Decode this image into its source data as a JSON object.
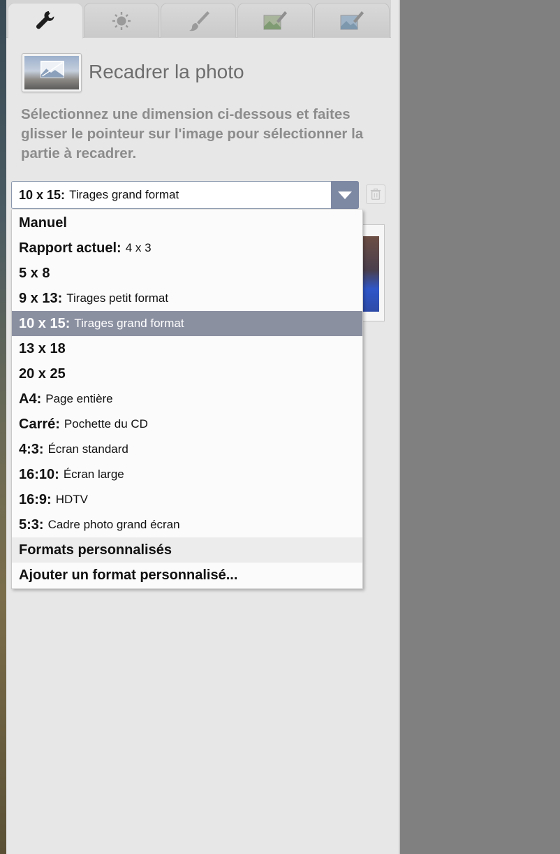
{
  "tabs": [
    {
      "icon": "wrench-icon",
      "active": true
    },
    {
      "icon": "sun-icon",
      "active": false
    },
    {
      "icon": "brush-icon",
      "active": false
    },
    {
      "icon": "image-brush-green-icon",
      "active": false
    },
    {
      "icon": "image-brush-blue-icon",
      "active": false
    }
  ],
  "header": {
    "title": "Recadrer la photo",
    "instructions": "Sélectionnez une dimension ci-dessous et faites glisser le pointeur sur l'image pour sélectionner la partie à recadrer."
  },
  "select": {
    "selected_bold": "10 x 15:",
    "selected_desc": "Tirages grand format"
  },
  "options": [
    {
      "bold": "Manuel",
      "desc": ""
    },
    {
      "bold": "Rapport actuel:",
      "desc": "4 x 3"
    },
    {
      "bold": "5 x 8",
      "desc": ""
    },
    {
      "bold": "9 x 13:",
      "desc": "Tirages petit format"
    },
    {
      "bold": "10 x 15:",
      "desc": "Tirages grand format"
    },
    {
      "bold": "13 x 18",
      "desc": ""
    },
    {
      "bold": "20 x 25",
      "desc": ""
    },
    {
      "bold": "A4:",
      "desc": "Page entière"
    },
    {
      "bold": "Carré:",
      "desc": "Pochette du CD"
    },
    {
      "bold": "4:3:",
      "desc": "Écran standard"
    },
    {
      "bold": "16:10:",
      "desc": "Écran large"
    },
    {
      "bold": "16:9:",
      "desc": "HDTV"
    },
    {
      "bold": "5:3:",
      "desc": "Cadre photo grand écran"
    },
    {
      "bold": "Formats personnalisés",
      "desc": ""
    },
    {
      "bold": "Ajouter un format personnalisé...",
      "desc": ""
    }
  ],
  "colors": {
    "panel_bg": "#e7e7e7",
    "selected_option_bg": "#8b90a1",
    "select_button": "#7d88a3",
    "workspace_bg": "#808080"
  }
}
